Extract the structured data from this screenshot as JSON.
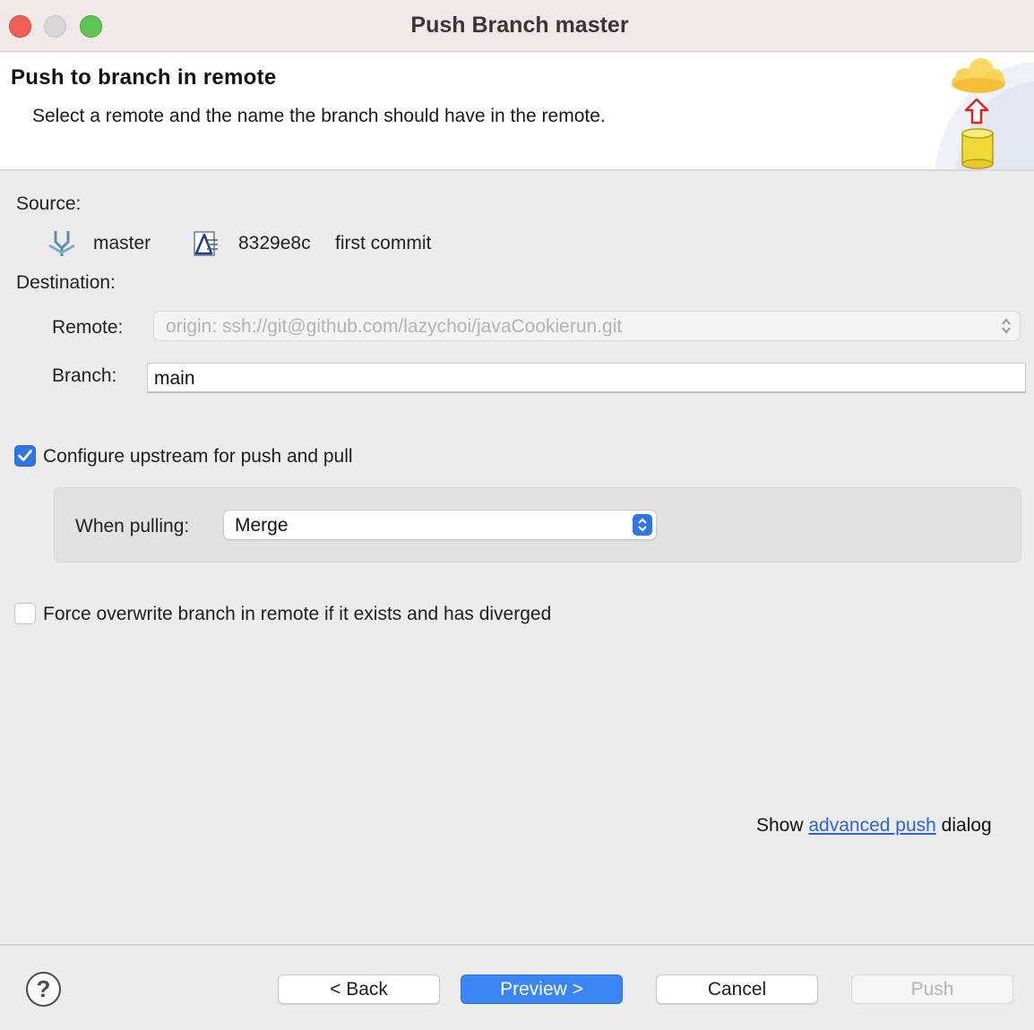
{
  "window": {
    "title": "Push Branch master"
  },
  "banner": {
    "heading": "Push to branch in remote",
    "description": "Select a remote and the name the branch should have in the remote."
  },
  "source": {
    "label": "Source:",
    "branch": "master",
    "commit_id": "8329e8c",
    "commit_message": "first commit"
  },
  "destination": {
    "label": "Destination:",
    "remote_label": "Remote:",
    "remote_value": "origin: ssh://git@github.com/lazychoi/javaCookierun.git",
    "branch_label": "Branch:",
    "branch_value": "main"
  },
  "upstream": {
    "label": "Configure upstream for push and pull",
    "checked": true,
    "pulling_label": "When pulling:",
    "pulling_value": "Merge"
  },
  "force": {
    "label": "Force overwrite branch in remote if it exists and has diverged",
    "checked": false
  },
  "advanced": {
    "prefix": "Show",
    "link": "advanced push",
    "suffix": "dialog"
  },
  "buttons": {
    "help": "?",
    "back": "< Back",
    "preview": "Preview >",
    "cancel": "Cancel",
    "push": "Push"
  },
  "colors": {
    "accent": "#3a84f4",
    "link": "#2d63d6",
    "close": "#ee5f57",
    "zoom": "#5fc454"
  }
}
